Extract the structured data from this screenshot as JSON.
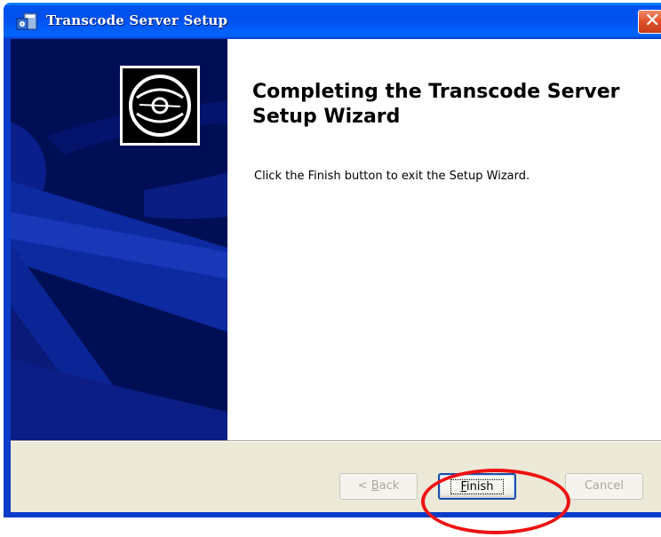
{
  "window": {
    "title": "Transcode Server Setup",
    "title_icon": "installer-icon",
    "close_icon": "close-icon"
  },
  "banner": {
    "icon": "cd-disc-icon"
  },
  "content": {
    "heading": "Completing the Transcode Server Setup Wizard",
    "description": "Click the Finish button to exit the Setup Wizard."
  },
  "buttons": {
    "back": {
      "prefix": "< ",
      "mnemonic": "B",
      "rest": "ack",
      "enabled": false
    },
    "finish": {
      "mnemonic": "F",
      "rest": "inish",
      "enabled": true
    },
    "cancel": {
      "label": "Cancel",
      "enabled": false
    }
  },
  "colors": {
    "banner": "#000f55",
    "accent_ring": "#ee1111",
    "titlebar": "#0053ee"
  }
}
